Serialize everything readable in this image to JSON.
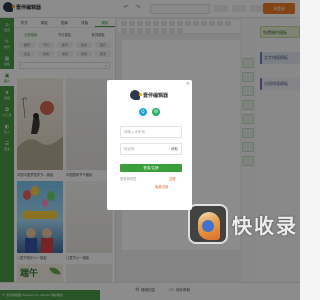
{
  "app": {
    "logo_text": "壹伴编辑器",
    "login_button": "未登录"
  },
  "leftnav": {
    "items": [
      {
        "icon": "⌂",
        "label": "首页"
      },
      {
        "icon": "✎",
        "label": "样式"
      },
      {
        "icon": "▦",
        "label": "模板"
      },
      {
        "icon": "▣",
        "label": "图片"
      },
      {
        "icon": "★",
        "label": "收藏"
      },
      {
        "icon": "✿",
        "label": "AI工具"
      },
      {
        "icon": "◐",
        "label": "导入"
      },
      {
        "icon": "☰",
        "label": "更多"
      }
    ],
    "active_index": 3
  },
  "panel": {
    "tabs": [
      "样式",
      "模板",
      "图库",
      "排版",
      "模板"
    ],
    "active_tab": 4,
    "subtabs": [
      "全部模板",
      "节日模板",
      "我的模板"
    ],
    "active_subtab": 0,
    "tags": [
      "推荐",
      "节日",
      "教育",
      "政务",
      "医疗",
      "企业",
      "科技",
      "美妆",
      "旅游",
      "更多"
    ]
  },
  "cards": [
    {
      "caption": "中国中国梦国学节…模板"
    },
    {
      "caption": "中国国风节气模板"
    },
    {
      "caption": "儿童节快乐六一模板"
    },
    {
      "caption": "儿童节六一模板"
    },
    {
      "caption": "端午"
    }
  ],
  "rightstyles": {
    "items": [
      {
        "text": "免费稿件模板",
        "color": "#e8f3d6",
        "fg": "#3f6d22"
      },
      {
        "text": "文字排版模板",
        "color": "#e4e8f4",
        "fg": "#4a5a8a"
      },
      {
        "text": "分段排版模板",
        "color": "#eef0f8",
        "fg": "#4a5a8a"
      }
    ]
  },
  "modal": {
    "logo_text": "壹伴编辑器",
    "phone_placeholder": "请输入手机号",
    "code_placeholder": "验证码",
    "get_code_label": "获取",
    "submit_label": "登录/注册",
    "agree_text": "登录即同意",
    "link_text": "注册",
    "bottom_link": "免费试用",
    "close_label": "×"
  },
  "footer": {
    "left_text": "© 壹伴编辑器 Powered by Weixin 保护版权",
    "undo_label": "撤销回复",
    "save_label": "保存草稿"
  },
  "watermark": {
    "text": "快收录"
  },
  "colors": {
    "brand_green": "#4a9a4a",
    "accent_orange": "#ee7a25",
    "wechat_green": "#2aae67",
    "qq_blue": "#1fa2dd"
  }
}
